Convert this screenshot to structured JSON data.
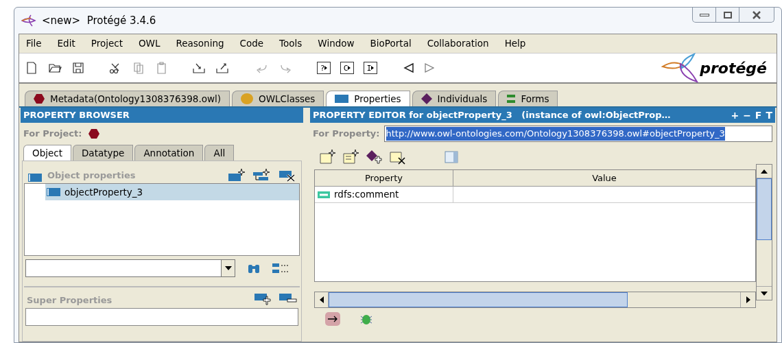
{
  "window": {
    "title": "<new>  Protégé 3.4.6"
  },
  "menu": [
    {
      "label": "File"
    },
    {
      "label": "Edit"
    },
    {
      "label": "Project"
    },
    {
      "label": "OWL"
    },
    {
      "label": "Reasoning"
    },
    {
      "label": "Code"
    },
    {
      "label": "Tools"
    },
    {
      "label": "Window"
    },
    {
      "label": "BioPortal"
    },
    {
      "label": "Collaboration"
    },
    {
      "label": "Help"
    }
  ],
  "toolbar": {
    "buttons": [
      {
        "kind": "text",
        "label": "?"
      },
      {
        "kind": "text",
        "label": "C"
      },
      {
        "kind": "text",
        "label": "I"
      }
    ],
    "logo": "protégé"
  },
  "tabs": [
    {
      "label": "Metadata(Ontology1308376398.owl)",
      "kind": "hexagon",
      "selected": false
    },
    {
      "label": "OWLClasses",
      "kind": "circle",
      "selected": false
    },
    {
      "label": "Properties",
      "kind": "rect",
      "selected": true
    },
    {
      "label": "Individuals",
      "kind": "diamond",
      "selected": false
    },
    {
      "label": "Forms",
      "kind": "bars",
      "selected": false
    }
  ],
  "browser": {
    "title": "PROPERTY BROWSER",
    "for_project": "For Project:",
    "tabs": [
      {
        "label": "Object",
        "selected": true
      },
      {
        "label": "Datatype",
        "selected": false
      },
      {
        "label": "Annotation",
        "selected": false
      },
      {
        "label": "All",
        "selected": false
      }
    ],
    "section": "Object properties",
    "tree": [
      {
        "label": "objectProperty_3",
        "selected": true
      }
    ],
    "super": "Super Properties"
  },
  "editor": {
    "title": "PROPERTY EDITOR for objectProperty_3   (instance of owl:ObjectProp…",
    "header_buttons": [
      "+",
      "−",
      "F",
      "T"
    ],
    "for_property": "For Property:",
    "uri": "http://www.owl-ontologies.com/Ontology1308376398.owl#objectProperty_3",
    "columns": [
      "Property",
      "Value"
    ],
    "rows": [
      {
        "property": "rdfs:comment"
      }
    ]
  }
}
